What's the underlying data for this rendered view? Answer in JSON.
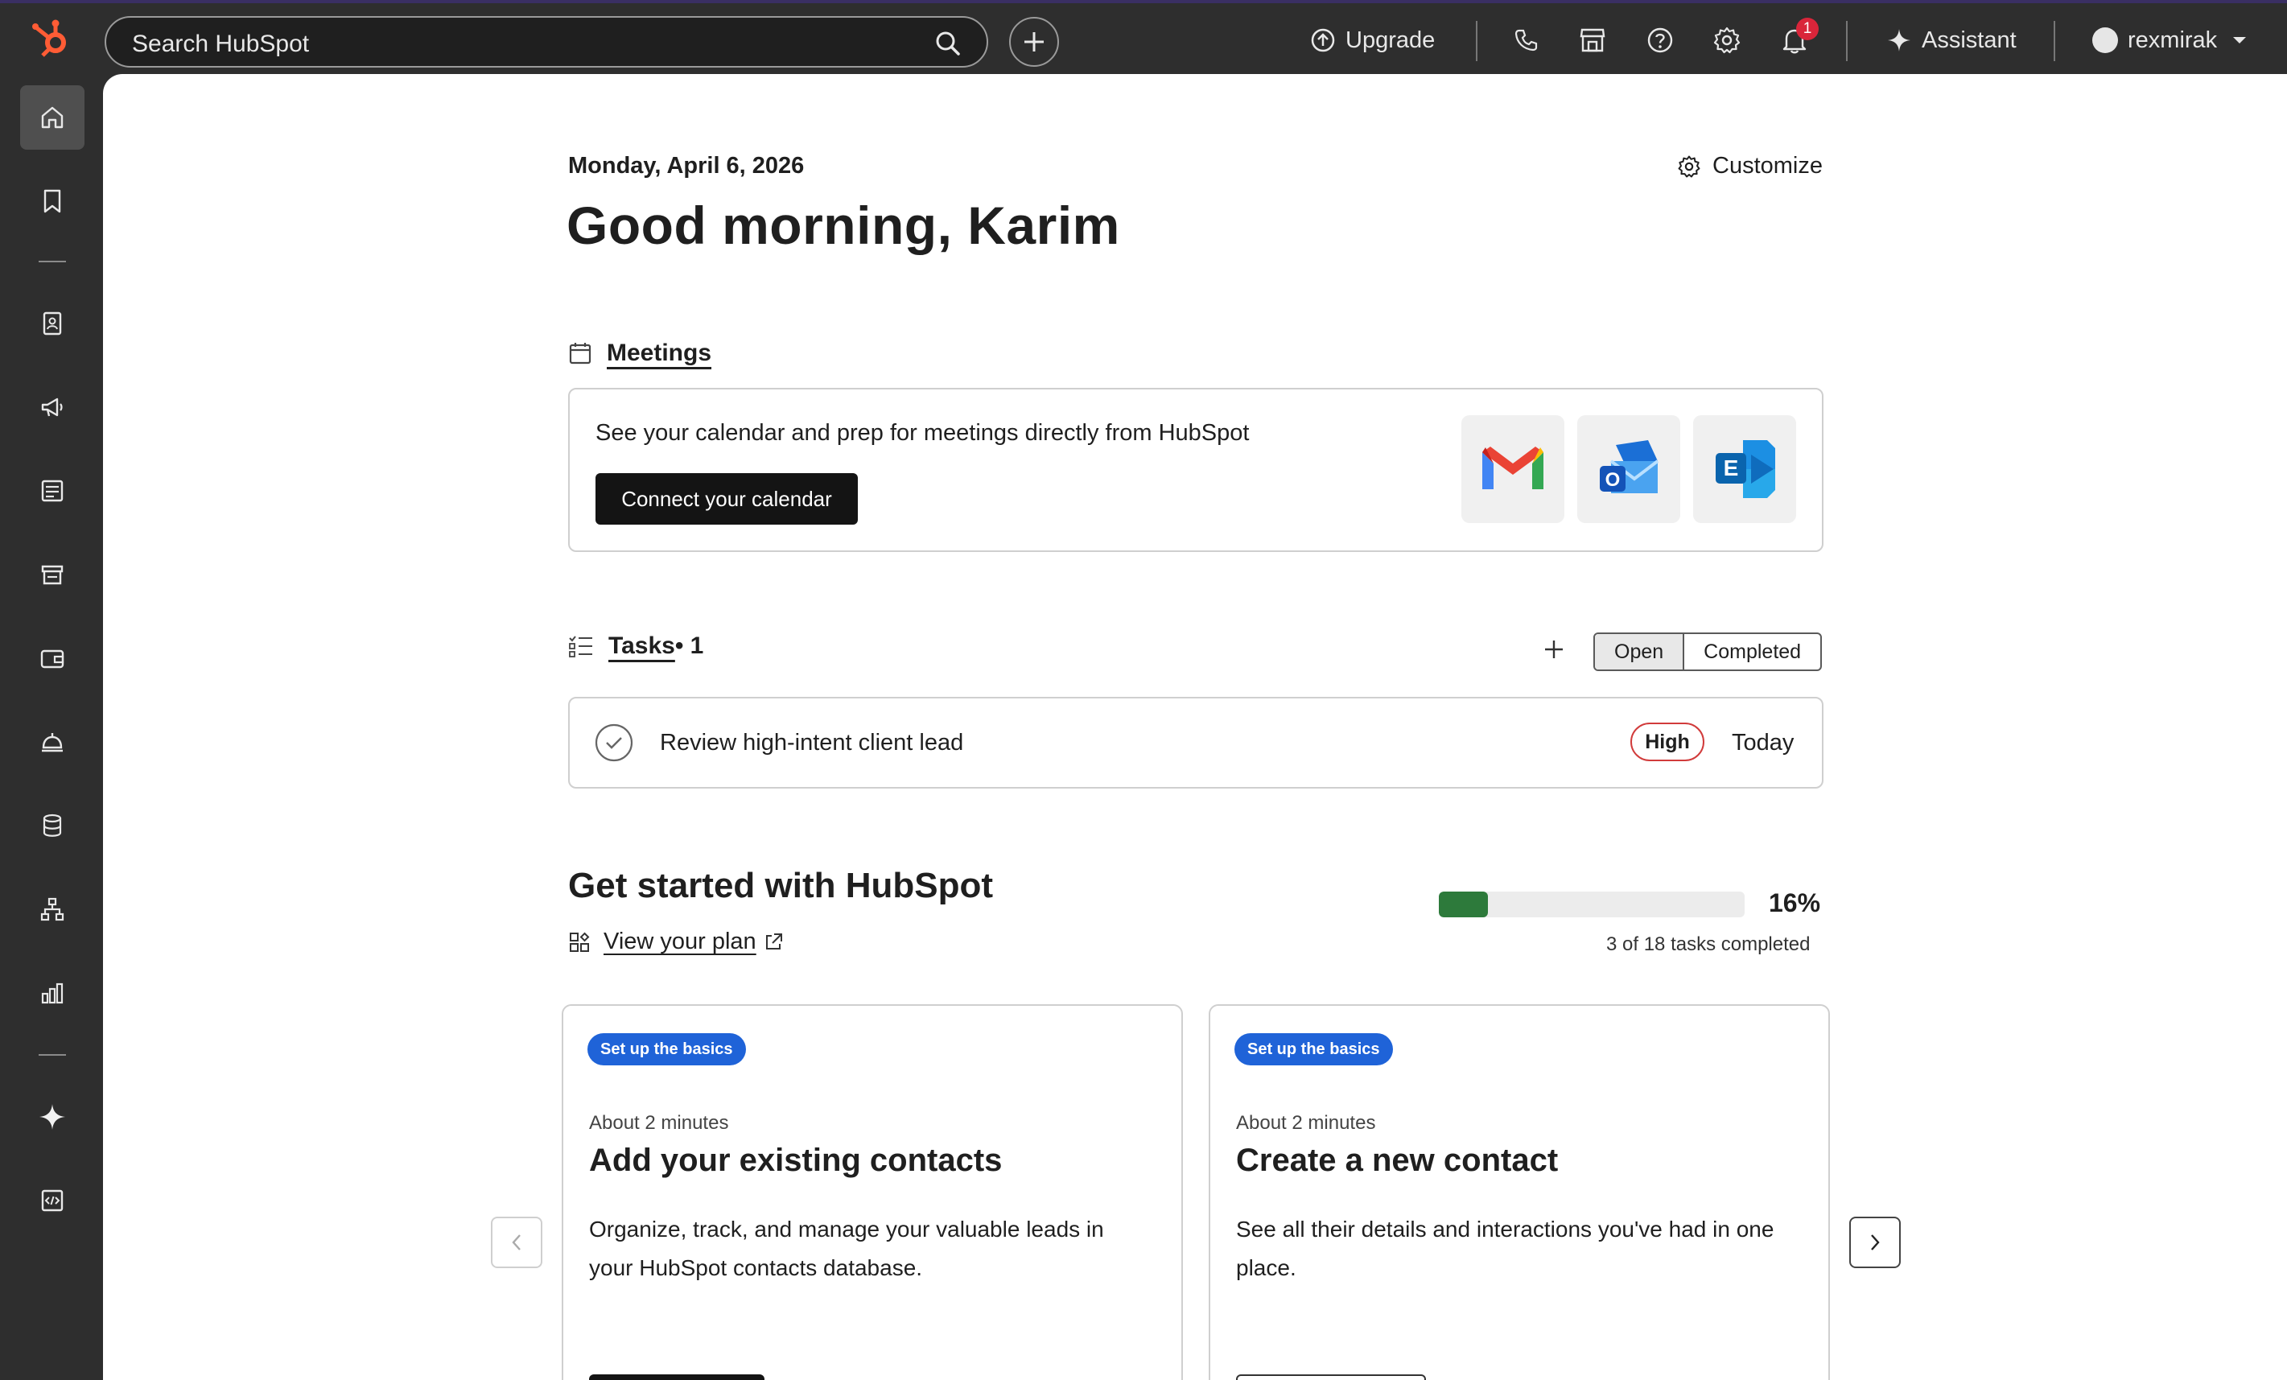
{
  "topbar": {
    "search_placeholder": "Search HubSpot",
    "upgrade_label": "Upgrade",
    "assistant_label": "Assistant",
    "account_name": "rexmirak",
    "notification_count": "1"
  },
  "sidebar": {
    "items": [
      "home-icon",
      "bookmark-icon",
      "contacts-icon",
      "marketing-icon",
      "content-icon",
      "commerce-icon",
      "wallet-icon",
      "service-icon",
      "data-icon",
      "automation-icon",
      "reporting-icon",
      "ai-icon",
      "developer-icon"
    ]
  },
  "header": {
    "date": "Monday, April 6, 2026",
    "greeting": "Good morning, Karim",
    "customize_label": "Customize"
  },
  "meetings": {
    "title": "Meetings",
    "description": "See your calendar and prep for meetings directly from HubSpot",
    "connect_button": "Connect your calendar",
    "apps": [
      "gmail-icon",
      "outlook-icon",
      "exchange-icon"
    ]
  },
  "tasks": {
    "title": "Tasks",
    "count_label": " • 1",
    "tabs": {
      "open": "Open",
      "completed": "Completed"
    },
    "items": [
      {
        "title": "Review high-intent client lead",
        "priority": "High",
        "due": "Today"
      }
    ]
  },
  "get_started": {
    "title": "Get started with HubSpot",
    "plan_link": "View your plan",
    "progress_percent": 16,
    "progress_label": "16%",
    "progress_sub": "3 of 18 tasks completed",
    "cards": [
      {
        "tag": "Set up the basics",
        "time": "About 2 minutes",
        "title": "Add your existing contacts",
        "description": "Organize, track, and manage your valuable leads in your HubSpot contacts database."
      },
      {
        "tag": "Set up the basics",
        "time": "About 2 minutes",
        "title": "Create a new contact",
        "description": "See all their details and interactions you've had in one place."
      }
    ]
  },
  "colors": {
    "accent_blue": "#1f63d8",
    "progress_green": "#2d7a3b",
    "brand_orange": "#ff5c35",
    "priority_red": "#d13b3b"
  }
}
